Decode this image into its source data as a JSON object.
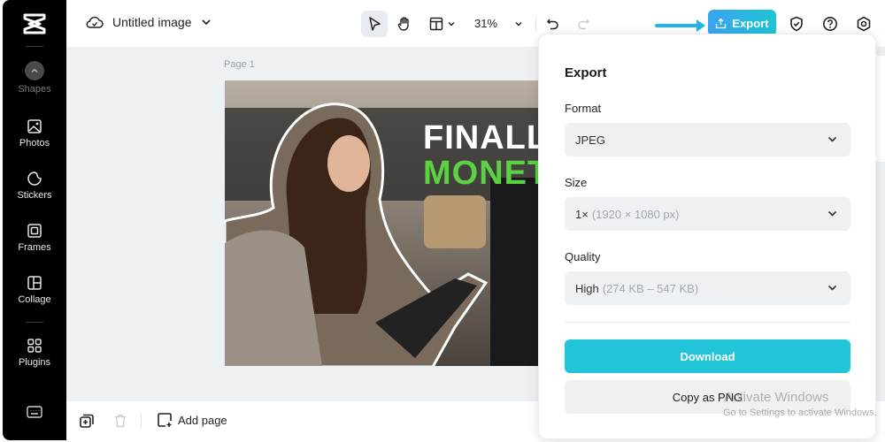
{
  "app": {
    "brand": "CapCut"
  },
  "sidebar": {
    "items": [
      {
        "id": "shapes",
        "label": "Shapes",
        "icon": "chevron-up-icon"
      },
      {
        "id": "photos",
        "label": "Photos",
        "icon": "image-icon"
      },
      {
        "id": "stickers",
        "label": "Stickers",
        "icon": "sticker-icon"
      },
      {
        "id": "frames",
        "label": "Frames",
        "icon": "frame-icon"
      },
      {
        "id": "collage",
        "label": "Collage",
        "icon": "collage-icon"
      },
      {
        "id": "plugins",
        "label": "Plugins",
        "icon": "grid-icon"
      }
    ],
    "bottom_icon": "keyboard-icon"
  },
  "topbar": {
    "title": "Untitled image",
    "zoom": "31%",
    "export_label": "Export"
  },
  "canvas": {
    "page_label": "Page 1",
    "thumbnail": {
      "line1": "FINALL",
      "line2": "MONET"
    }
  },
  "bottombar": {
    "add_page_label": "Add page"
  },
  "export_panel": {
    "title": "Export",
    "format": {
      "label": "Format",
      "value": "JPEG"
    },
    "size": {
      "label": "Size",
      "value": "1×",
      "detail": "(1920 × 1080 px)"
    },
    "quality": {
      "label": "Quality",
      "value": "High",
      "detail": "(274 KB – 547 KB)"
    },
    "download_label": "Download",
    "copy_label": "Copy as PNG"
  },
  "watermark": {
    "line1": "Activate Windows",
    "line2": "Go to Settings to activate Windows."
  },
  "colors": {
    "accent": "#21c4d8",
    "export_gradient_start": "#3aa3ef",
    "export_gradient_end": "#1ec5d6",
    "thumbnail_green": "#5bd143"
  }
}
